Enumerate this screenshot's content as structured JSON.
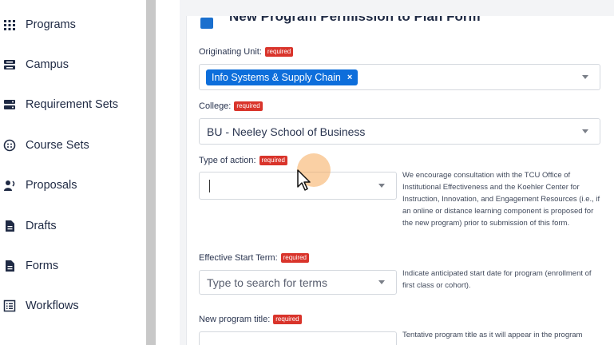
{
  "sidebar": {
    "items": [
      {
        "label": "Programs",
        "icon": "grid-icon"
      },
      {
        "label": "Campus",
        "icon": "campus-icon"
      },
      {
        "label": "Requirement Sets",
        "icon": "server-icon"
      },
      {
        "label": "Course Sets",
        "icon": "course-sets-icon"
      },
      {
        "label": "Proposals",
        "icon": "proposals-icon"
      },
      {
        "label": "Drafts",
        "icon": "document-icon"
      },
      {
        "label": "Forms",
        "icon": "document-icon"
      },
      {
        "label": "Workflows",
        "icon": "list-icon"
      }
    ]
  },
  "form": {
    "title": "New Program Permission to Plan Form",
    "required_badge": "required",
    "originating_unit": {
      "label": "Originating Unit:",
      "tag": "Info Systems & Supply Chain",
      "tag_remove": "×"
    },
    "college": {
      "label": "College:",
      "value": "BU - Neeley School of Business"
    },
    "type_of_action": {
      "label": "Type of action:",
      "value": "",
      "help": "We encourage consultation with the TCU Office of Institutional Effectiveness and the Koehler Center for Instruction, Innovation, and Engagement Resources (i.e., if an online or distance learning component is proposed for the new program) prior to submission of this form."
    },
    "effective_start_term": {
      "label": "Effective Start Term:",
      "placeholder": "Type to search for terms",
      "help": "Indicate anticipated start date for program (enrollment of first class or cohort)."
    },
    "new_program_title": {
      "label": "New program title:",
      "help": "Tentative program title as it will appear in the program"
    }
  },
  "colors": {
    "accent": "#0d6edb",
    "required": "#d9342b",
    "click_highlight": "#f5aa5a"
  }
}
